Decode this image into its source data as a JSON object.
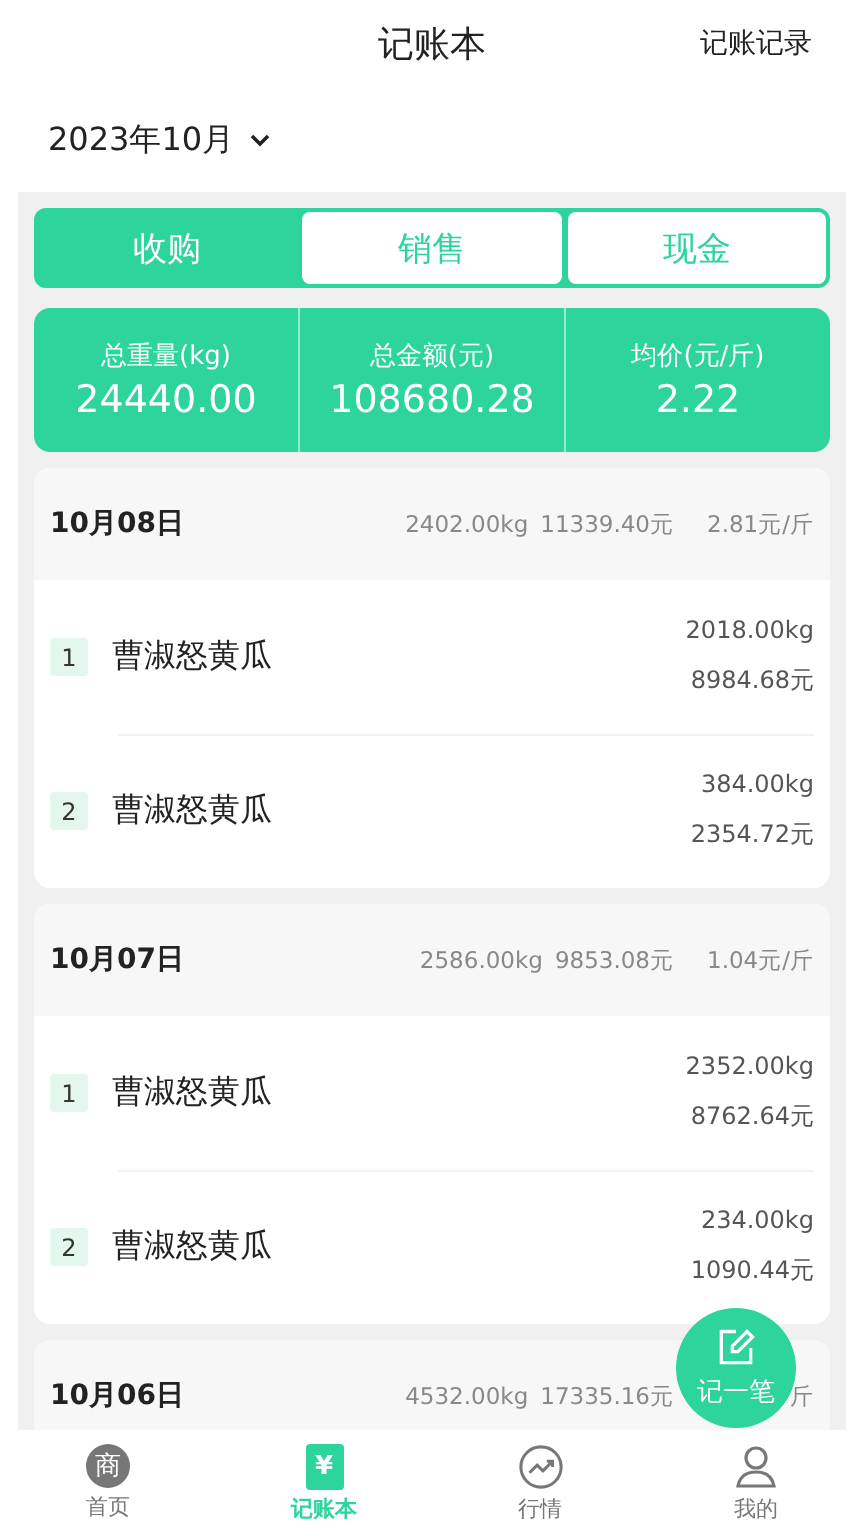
{
  "header": {
    "title": "记账本",
    "action": "记账记录"
  },
  "month": "2023年10月",
  "tabs": [
    {
      "label": "收购",
      "selected": true
    },
    {
      "label": "销售",
      "selected": false
    },
    {
      "label": "现金",
      "selected": false
    }
  ],
  "totals": [
    {
      "label": "总重量(kg)",
      "value": "24440.00"
    },
    {
      "label": "总金额(元)",
      "value": "108680.28"
    },
    {
      "label": "均价(元/斤)",
      "value": "2.22"
    }
  ],
  "days": [
    {
      "date": "10月08日",
      "weight": "2402.00kg",
      "amount": "11339.40元",
      "price": "2.81元/斤",
      "items": [
        {
          "index": "1",
          "name": "曹淑怒黄瓜",
          "weight": "2018.00kg",
          "amount": "8984.68元"
        },
        {
          "index": "2",
          "name": "曹淑怒黄瓜",
          "weight": "384.00kg",
          "amount": "2354.72元"
        }
      ]
    },
    {
      "date": "10月07日",
      "weight": "2586.00kg",
      "amount": "9853.08元",
      "price": "1.04元/斤",
      "items": [
        {
          "index": "1",
          "name": "曹淑怒黄瓜",
          "weight": "2352.00kg",
          "amount": "8762.64元"
        },
        {
          "index": "2",
          "name": "曹淑怒黄瓜",
          "weight": "234.00kg",
          "amount": "1090.44元"
        }
      ]
    },
    {
      "date": "10月06日",
      "weight": "4532.00kg",
      "amount": "17335.16元",
      "price": "斤"
    }
  ],
  "fab": {
    "label": "记一笔"
  },
  "nav": [
    {
      "kind": "shop",
      "label": "首页",
      "glyph": "商",
      "selected": false
    },
    {
      "kind": "ledger",
      "label": "记账本",
      "glyph": "¥",
      "selected": true
    },
    {
      "kind": "market",
      "label": "行情",
      "selected": false
    },
    {
      "kind": "profile",
      "label": "我的",
      "selected": false
    }
  ]
}
